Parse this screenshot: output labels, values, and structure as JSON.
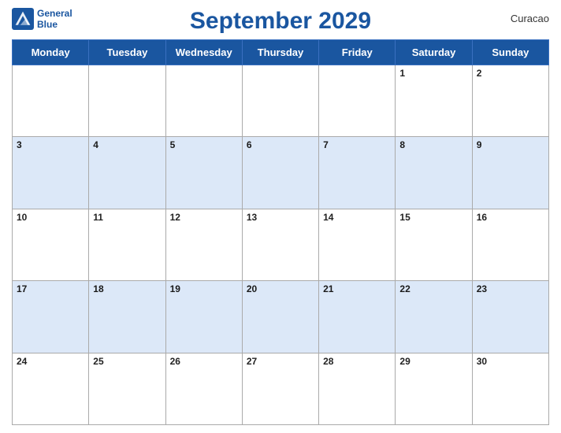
{
  "header": {
    "title": "September 2029",
    "region": "Curacao",
    "logo_line1": "General",
    "logo_line2": "Blue"
  },
  "days_of_week": [
    "Monday",
    "Tuesday",
    "Wednesday",
    "Thursday",
    "Friday",
    "Saturday",
    "Sunday"
  ],
  "weeks": [
    [
      {
        "num": "",
        "empty": true
      },
      {
        "num": "",
        "empty": true
      },
      {
        "num": "",
        "empty": true
      },
      {
        "num": "",
        "empty": true
      },
      {
        "num": "",
        "empty": true
      },
      {
        "num": "1"
      },
      {
        "num": "2"
      }
    ],
    [
      {
        "num": "3"
      },
      {
        "num": "4"
      },
      {
        "num": "5"
      },
      {
        "num": "6"
      },
      {
        "num": "7"
      },
      {
        "num": "8"
      },
      {
        "num": "9"
      }
    ],
    [
      {
        "num": "10"
      },
      {
        "num": "11"
      },
      {
        "num": "12"
      },
      {
        "num": "13"
      },
      {
        "num": "14"
      },
      {
        "num": "15"
      },
      {
        "num": "16"
      }
    ],
    [
      {
        "num": "17"
      },
      {
        "num": "18"
      },
      {
        "num": "19"
      },
      {
        "num": "20"
      },
      {
        "num": "21"
      },
      {
        "num": "22"
      },
      {
        "num": "23"
      }
    ],
    [
      {
        "num": "24"
      },
      {
        "num": "25"
      },
      {
        "num": "26"
      },
      {
        "num": "27"
      },
      {
        "num": "28"
      },
      {
        "num": "29"
      },
      {
        "num": "30"
      }
    ]
  ],
  "colors": {
    "header_bg": "#1a56a0",
    "stripe_bg": "#dce8f8",
    "white": "#ffffff"
  }
}
